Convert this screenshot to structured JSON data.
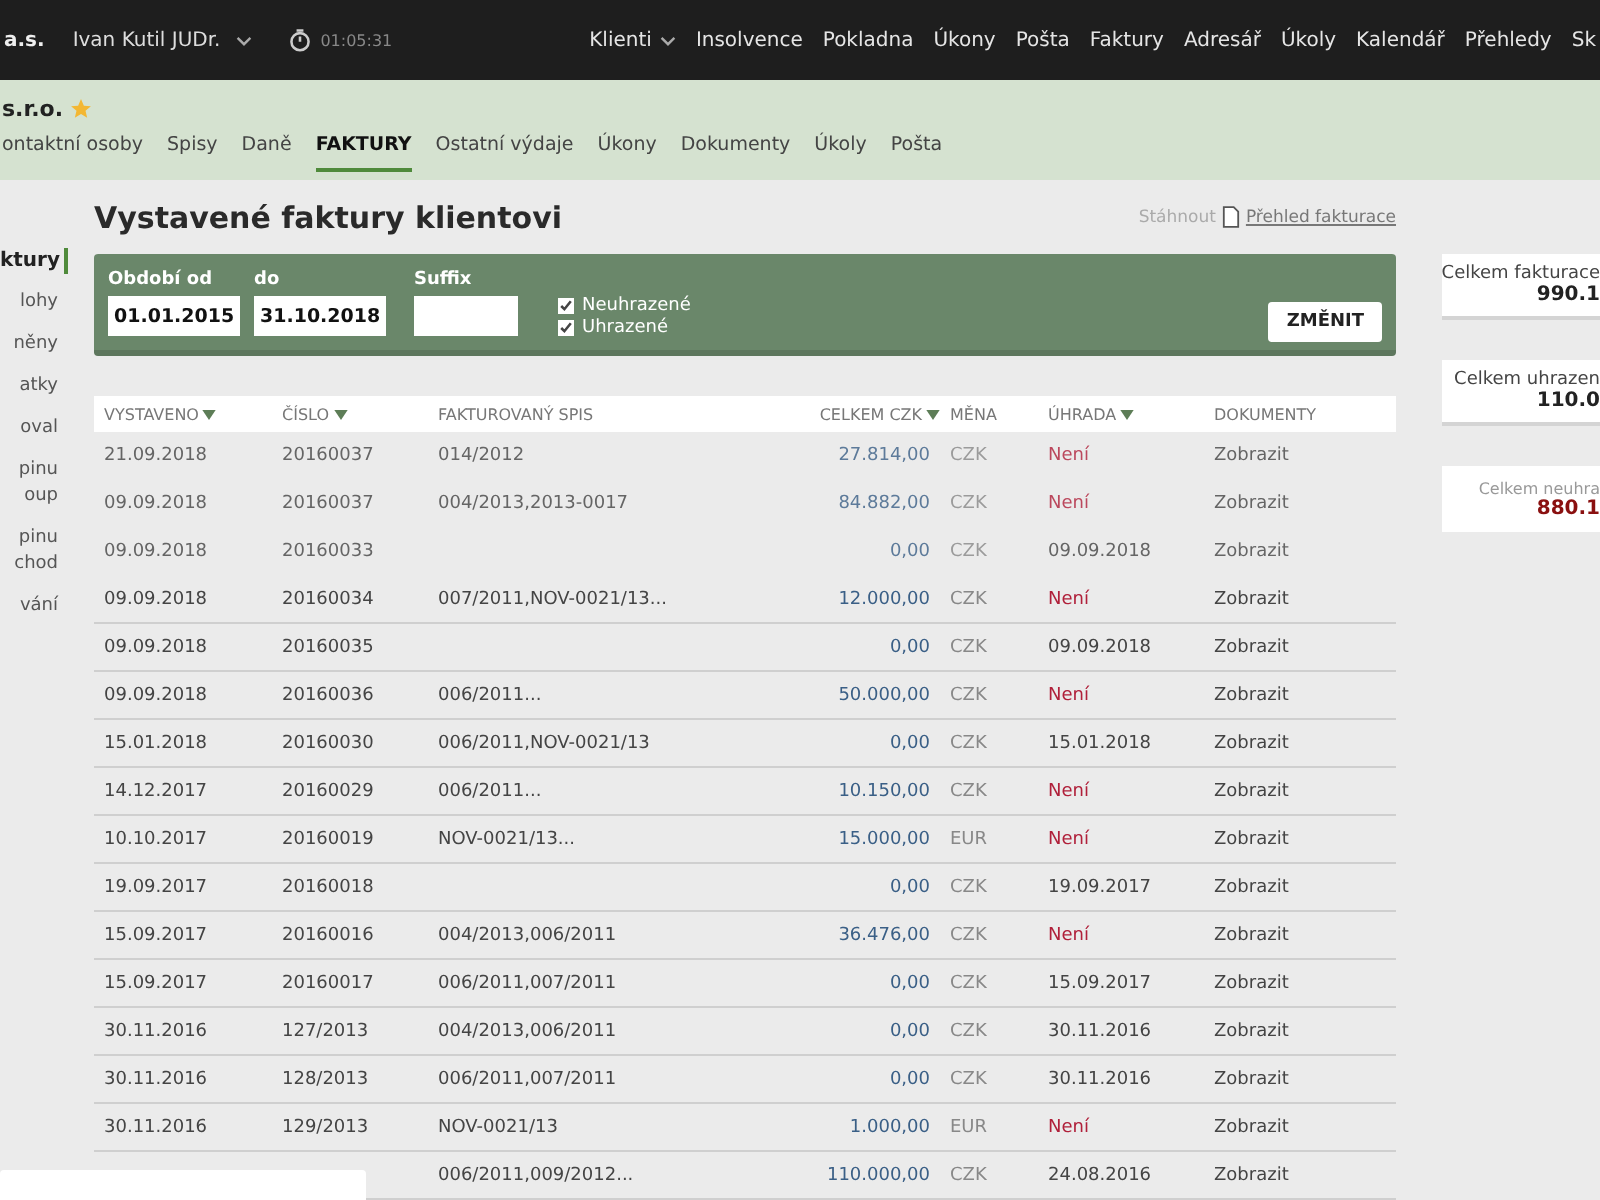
{
  "top_bar": {
    "company": "a.s.",
    "user": "Ivan Kutil JUDr.",
    "timer": "01:05:31",
    "nav": [
      {
        "label": "Klienti",
        "dropdown": true
      },
      {
        "label": "Insolvence",
        "dropdown": false
      },
      {
        "label": "Pokladna",
        "dropdown": false
      },
      {
        "label": "Úkony",
        "dropdown": false
      },
      {
        "label": "Pošta",
        "dropdown": false
      },
      {
        "label": "Faktury",
        "dropdown": false
      },
      {
        "label": "Adresář",
        "dropdown": false
      },
      {
        "label": "Úkoly",
        "dropdown": false
      },
      {
        "label": "Kalendář",
        "dropdown": false
      },
      {
        "label": "Přehledy",
        "dropdown": false
      },
      {
        "label": "Sk",
        "dropdown": false
      }
    ]
  },
  "client": {
    "name": "s.r.o.",
    "favorite": true,
    "tabs": [
      {
        "label": "ontaktní osoby",
        "selected": false
      },
      {
        "label": "Spisy",
        "selected": false
      },
      {
        "label": "Daně",
        "selected": false
      },
      {
        "label": "FAKTURY",
        "selected": true
      },
      {
        "label": "Ostatní výdaje",
        "selected": false
      },
      {
        "label": "Úkony",
        "selected": false
      },
      {
        "label": "Dokumenty",
        "selected": false
      },
      {
        "label": "Úkoly",
        "selected": false
      },
      {
        "label": "Pošta",
        "selected": false
      }
    ]
  },
  "sidebar": {
    "items": [
      {
        "lines": [
          "ktury"
        ],
        "selected": true
      },
      {
        "lines": [
          "lohy"
        ],
        "selected": false
      },
      {
        "lines": [
          "něny"
        ],
        "selected": false
      },
      {
        "lines": [
          "atky"
        ],
        "selected": false
      },
      {
        "lines": [
          "oval"
        ],
        "selected": false
      },
      {
        "lines": [
          "pinu",
          "oup"
        ],
        "selected": false
      },
      {
        "lines": [
          "pinu",
          "chod"
        ],
        "selected": false
      },
      {
        "lines": [
          "vání"
        ],
        "selected": false
      }
    ]
  },
  "page": {
    "title": "Vystavené faktury klientovi",
    "download_label": "Stáhnout",
    "download_link": "Přehled fakturace"
  },
  "filter": {
    "from_label": "Období od",
    "from_value": "01.01.2015",
    "to_label": "do",
    "to_value": "31.10.2018",
    "suffix_label": "Suffix",
    "checkboxes": [
      {
        "label": "Neuhrazené",
        "checked": true
      },
      {
        "label": "Uhrazené",
        "checked": true
      }
    ],
    "button": "ZMĚNIT"
  },
  "table": {
    "columns": [
      {
        "label": "VYSTAVENO",
        "sort": true
      },
      {
        "label": "ČÍSLO",
        "sort": true
      },
      {
        "label": "FAKTUROVANÝ SPIS",
        "sort": false
      },
      {
        "label": "CELKEM CZK",
        "sort": true
      },
      {
        "label": "MĚNA",
        "sort": false
      },
      {
        "label": "ÚHRADA",
        "sort": true
      },
      {
        "label": "DOKUMENTY",
        "sort": false
      }
    ],
    "rows": [
      {
        "faded": true,
        "issued": "21.09.2018",
        "number": "20160037",
        "case": "014/2012",
        "total": "27.814,00",
        "currency": "CZK",
        "payment": "Není",
        "paid": false,
        "docs": "Zobrazit"
      },
      {
        "faded": true,
        "issued": "09.09.2018",
        "number": "20160037",
        "case": "004/2013,2013-0017",
        "total": "84.882,00",
        "currency": "CZK",
        "payment": "Není",
        "paid": false,
        "docs": "Zobrazit"
      },
      {
        "faded": true,
        "issued": "09.09.2018",
        "number": "20160033",
        "total": "0,00",
        "currency": "CZK",
        "payment": "09.09.2018",
        "paid": true,
        "docs": "Zobrazit"
      },
      {
        "faded": false,
        "issued": "09.09.2018",
        "number": "20160034",
        "case": "007/2011,NOV-0021/13...",
        "total": "12.000,00",
        "currency": "CZK",
        "payment": "Není",
        "paid": false,
        "docs": "Zobrazit"
      },
      {
        "faded": false,
        "issued": "09.09.2018",
        "number": "20160035",
        "total": "0,00",
        "currency": "CZK",
        "payment": "09.09.2018",
        "paid": true,
        "docs": "Zobrazit"
      },
      {
        "faded": false,
        "issued": "09.09.2018",
        "number": "20160036",
        "case": "006/2011...",
        "total": "50.000,00",
        "currency": "CZK",
        "payment": "Není",
        "paid": false,
        "docs": "Zobrazit"
      },
      {
        "faded": false,
        "issued": "15.01.2018",
        "number": "20160030",
        "case": "006/2011,NOV-0021/13",
        "total": "0,00",
        "currency": "CZK",
        "payment": "15.01.2018",
        "paid": true,
        "docs": "Zobrazit"
      },
      {
        "faded": false,
        "issued": "14.12.2017",
        "number": "20160029",
        "case": "006/2011...",
        "total": "10.150,00",
        "currency": "CZK",
        "payment": "Není",
        "paid": false,
        "docs": "Zobrazit"
      },
      {
        "faded": false,
        "issued": "10.10.2017",
        "number": "20160019",
        "case": "NOV-0021/13...",
        "total": "15.000,00",
        "currency": "EUR",
        "payment": "Není",
        "paid": false,
        "docs": "Zobrazit"
      },
      {
        "faded": false,
        "issued": "19.09.2017",
        "number": "20160018",
        "total": "0,00",
        "currency": "CZK",
        "payment": "19.09.2017",
        "paid": true,
        "docs": "Zobrazit"
      },
      {
        "faded": false,
        "issued": "15.09.2017",
        "number": "20160016",
        "case": "004/2013,006/2011",
        "total": "36.476,00",
        "currency": "CZK",
        "payment": "Není",
        "paid": false,
        "docs": "Zobrazit"
      },
      {
        "faded": false,
        "issued": "15.09.2017",
        "number": "20160017",
        "case": "006/2011,007/2011",
        "total": "0,00",
        "currency": "CZK",
        "payment": "15.09.2017",
        "paid": true,
        "docs": "Zobrazit"
      },
      {
        "faded": false,
        "issued": "30.11.2016",
        "number": "127/2013",
        "case": "004/2013,006/2011",
        "total": "0,00",
        "currency": "CZK",
        "payment": "30.11.2016",
        "paid": true,
        "docs": "Zobrazit"
      },
      {
        "faded": false,
        "issued": "30.11.2016",
        "number": "128/2013",
        "case": "006/2011,007/2011",
        "total": "0,00",
        "currency": "CZK",
        "payment": "30.11.2016",
        "paid": true,
        "docs": "Zobrazit"
      },
      {
        "faded": false,
        "issued": "30.11.2016",
        "number": "129/2013",
        "case": "NOV-0021/13",
        "total": "1.000,00",
        "currency": "EUR",
        "payment": "Není",
        "paid": false,
        "docs": "Zobrazit"
      },
      {
        "faded": false,
        "case": "006/2011,009/2012...",
        "total": "110.000,00",
        "currency": "CZK",
        "payment": "24.08.2016",
        "paid": true,
        "docs": "Zobrazit"
      }
    ]
  },
  "summary": [
    {
      "label": "Celkem fakturace",
      "value": "990.1",
      "kind": "normal"
    },
    {
      "label": "Celkem uhrazen",
      "value": "110.0",
      "kind": "normal"
    },
    {
      "label": "Celkem neuhra",
      "value": "880.1",
      "kind": "due"
    }
  ]
}
